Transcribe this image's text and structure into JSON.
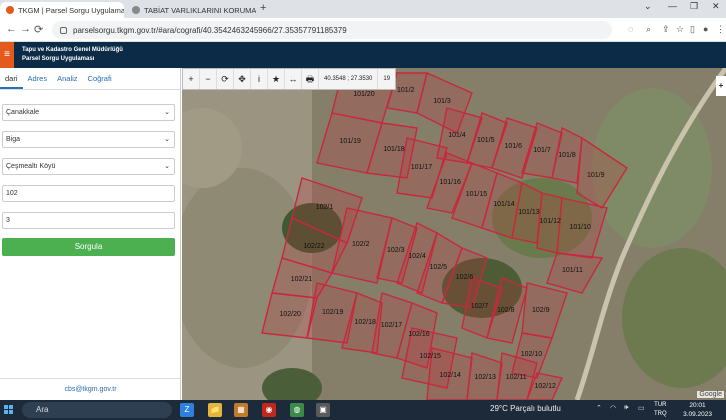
{
  "browser": {
    "tabs": [
      {
        "label": "TKGM | Parsel Sorgu Uygulaması",
        "close": "×"
      },
      {
        "label": "TABİAT VARLIKLARINI KORUMA",
        "close": "×"
      }
    ],
    "new_tab": "+",
    "url": "parselsorgu.tkgm.gov.tr/#ara/cografi/40.3542463245966/27.35357791185379",
    "window_controls": [
      "⌄",
      "—",
      "❐",
      "✕"
    ],
    "nav": {
      "back": "←",
      "forward": "→",
      "reload": "⟳"
    },
    "toolbar_icons": [
      "eye-off-icon",
      "zoom-icon",
      "share-icon",
      "star-icon",
      "extensions-icon",
      "sidepanel-icon",
      "profile-icon",
      "menu-icon"
    ]
  },
  "app": {
    "menu_icon": "≡",
    "title_line1": "Tapu ve Kadastro Genel Müdürlüğü",
    "title_line2": "Parsel Sorgu Uygulaması"
  },
  "sidebar": {
    "tabs": [
      "dari",
      "Adres",
      "Analiz",
      "Coğrafi"
    ],
    "province": "Çanakkale",
    "district": "Biga",
    "neighborhood": "Çeşmealtı Köyü",
    "block": "102",
    "parcel": "3",
    "query_button": "Sorgula",
    "footer_email": "cbs@tkgm.gov.tr"
  },
  "map": {
    "tools": [
      "+",
      "−",
      "⟳",
      "✥",
      "i",
      "★",
      "↔",
      "🖶"
    ],
    "coordinate": "40.3548 ; 27.3530",
    "zoom": "19",
    "right_tool": "+",
    "logo": "Google",
    "parcel_color": "#c8283c",
    "parcels": [
      "101/20",
      "101/2",
      "101/3",
      "101/19",
      "101/18",
      "101/4",
      "101/5",
      "101/6",
      "101/7",
      "101/8",
      "101/9",
      "101/17",
      "101/16",
      "101/15",
      "101/14",
      "101/13",
      "101/12",
      "101/10",
      "101/11",
      "102/1",
      "102/22",
      "102/2",
      "102/3",
      "102/4",
      "102/21",
      "102/5",
      "102/6",
      "102/20",
      "102/19",
      "102/18",
      "102/17",
      "102/16",
      "102/7",
      "102/8",
      "102/9",
      "102/10",
      "102/15",
      "102/14",
      "102/13",
      "102/11",
      "102/12"
    ]
  },
  "taskbar": {
    "search_placeholder": "Ara",
    "weather": "29°C  Parçalı bulutlu",
    "lang_top": "TUR",
    "lang_bottom": "TRQ",
    "time": "20:01",
    "date": "3.09.2023",
    "apps": [
      "Z",
      "📁",
      "▦",
      "◉",
      "◍",
      "▣"
    ]
  }
}
